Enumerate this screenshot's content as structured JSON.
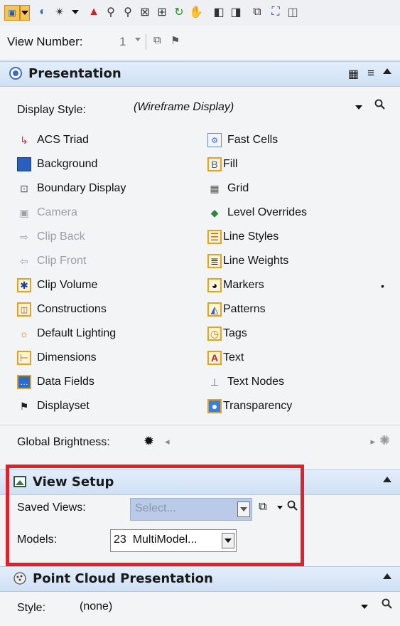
{
  "toolbar": {
    "icons": [
      "view-attributes-icon",
      "dropdown-arrow-icon",
      "analysis-icon",
      "light-icon",
      "menu-arrow-icon",
      "camera-icon",
      "zoom-in-icon",
      "zoom-out-icon",
      "fit-view-icon",
      "window-area-icon",
      "rotate-icon",
      "pan-icon",
      "view-previous-icon",
      "view-next-icon",
      "copy-view-icon",
      "clip-icon",
      "more-icon"
    ]
  },
  "view_number": {
    "label": "View Number:",
    "value": "1"
  },
  "presentation": {
    "title": "Presentation",
    "display_style_label": "Display Style:",
    "display_style_value": "(Wireframe Display)",
    "left_items": [
      {
        "label": "ACS Triad"
      },
      {
        "label": "Background"
      },
      {
        "label": "Boundary Display"
      },
      {
        "label": "Camera"
      },
      {
        "label": "Clip Back"
      },
      {
        "label": "Clip Front"
      },
      {
        "label": "Clip Volume"
      },
      {
        "label": "Constructions"
      },
      {
        "label": "Default Lighting"
      },
      {
        "label": "Dimensions"
      },
      {
        "label": "Data Fields"
      },
      {
        "label": "Displayset"
      }
    ],
    "right_items": [
      {
        "label": "Fast Cells"
      },
      {
        "label": "Fill"
      },
      {
        "label": "Grid"
      },
      {
        "label": "Level Overrides"
      },
      {
        "label": "Line Styles"
      },
      {
        "label": "Line Weights"
      },
      {
        "label": "Markers"
      },
      {
        "label": "Patterns"
      },
      {
        "label": "Tags"
      },
      {
        "label": "Text"
      },
      {
        "label": "Text Nodes"
      },
      {
        "label": "Transparency"
      }
    ],
    "global_brightness_label": "Global Brightness:"
  },
  "view_setup": {
    "title": "View Setup",
    "saved_views_label": "Saved Views:",
    "saved_views_value": "Select...",
    "models_label": "Models:",
    "models_value": "23  MultiModel..."
  },
  "point_cloud": {
    "title": "Point Cloud Presentation",
    "style_label": "Style:",
    "style_value": "(none)"
  }
}
